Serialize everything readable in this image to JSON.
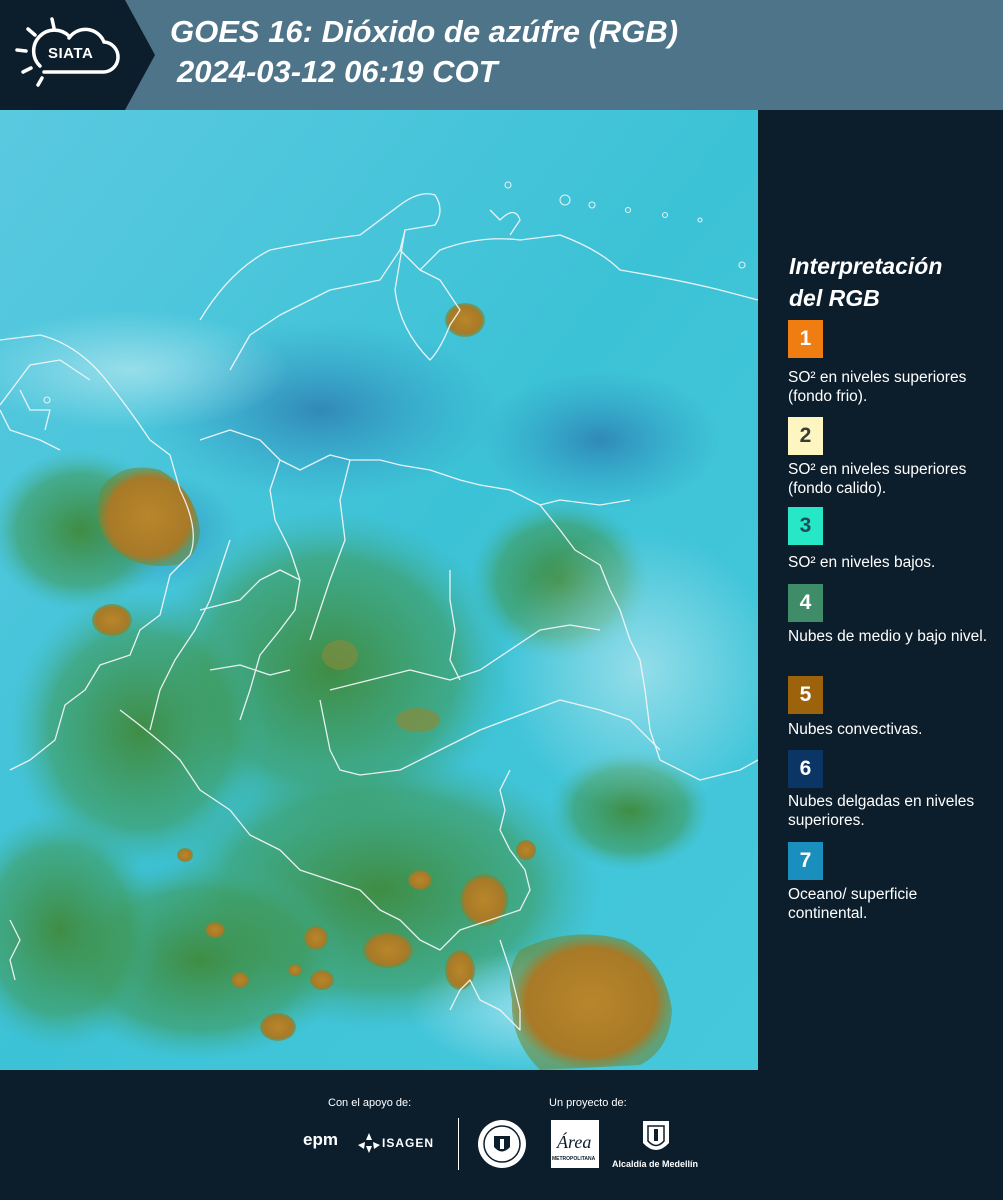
{
  "header": {
    "logo_text": "SIATA",
    "title_line1": "GOES 16: Dióxido de azúfre (RGB)",
    "title_line2": "2024-03-12 06:19 COT"
  },
  "legend": {
    "title_line1": "Interpretación",
    "title_line2": "del RGB",
    "items": [
      {
        "num": "1",
        "color": "#f07d12",
        "text_color": "#ffffff",
        "text": "SO² en niveles superiores (fondo frio)."
      },
      {
        "num": "2",
        "color": "#fdf6c0",
        "text_color": "#3a3a3a",
        "text": "SO² en niveles superiores (fondo calido)."
      },
      {
        "num": "3",
        "color": "#27e8c6",
        "text_color": "#1d4d5a",
        "text": "SO² en niveles bajos."
      },
      {
        "num": "4",
        "color": "#3e8d68",
        "text_color": "#ffffff",
        "text": "Nubes de medio y bajo nivel."
      },
      {
        "num": "5",
        "color": "#9c620c",
        "text_color": "#ffffff",
        "text": "Nubes convectivas."
      },
      {
        "num": "6",
        "color": "#0a3565",
        "text_color": "#ffffff",
        "text": "Nubes delgadas en niveles superiores."
      },
      {
        "num": "7",
        "color": "#1a8fbd",
        "text_color": "#ffffff",
        "text": "Oceano/ superficie continental."
      }
    ]
  },
  "footer": {
    "support_label": "Con el apoyo de:",
    "project_label": "Un proyecto de:",
    "epm": "epm",
    "isagen": "ISAGEN",
    "metropolitana": "METROPOLITANA",
    "alcaldia": "Alcaldía de Medellín"
  }
}
